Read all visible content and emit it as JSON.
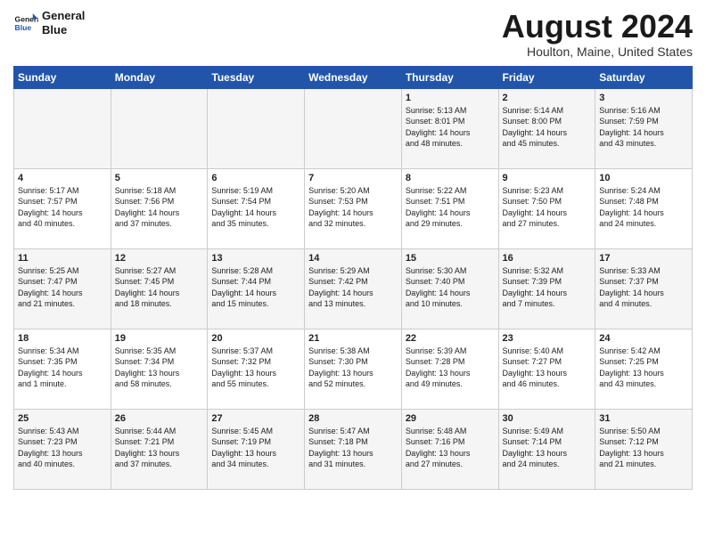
{
  "logo": {
    "line1": "General",
    "line2": "Blue"
  },
  "title": "August 2024",
  "location": "Houlton, Maine, United States",
  "headers": [
    "Sunday",
    "Monday",
    "Tuesday",
    "Wednesday",
    "Thursday",
    "Friday",
    "Saturday"
  ],
  "weeks": [
    [
      {
        "day": "",
        "detail": ""
      },
      {
        "day": "",
        "detail": ""
      },
      {
        "day": "",
        "detail": ""
      },
      {
        "day": "",
        "detail": ""
      },
      {
        "day": "1",
        "detail": "Sunrise: 5:13 AM\nSunset: 8:01 PM\nDaylight: 14 hours\nand 48 minutes."
      },
      {
        "day": "2",
        "detail": "Sunrise: 5:14 AM\nSunset: 8:00 PM\nDaylight: 14 hours\nand 45 minutes."
      },
      {
        "day": "3",
        "detail": "Sunrise: 5:16 AM\nSunset: 7:59 PM\nDaylight: 14 hours\nand 43 minutes."
      }
    ],
    [
      {
        "day": "4",
        "detail": "Sunrise: 5:17 AM\nSunset: 7:57 PM\nDaylight: 14 hours\nand 40 minutes."
      },
      {
        "day": "5",
        "detail": "Sunrise: 5:18 AM\nSunset: 7:56 PM\nDaylight: 14 hours\nand 37 minutes."
      },
      {
        "day": "6",
        "detail": "Sunrise: 5:19 AM\nSunset: 7:54 PM\nDaylight: 14 hours\nand 35 minutes."
      },
      {
        "day": "7",
        "detail": "Sunrise: 5:20 AM\nSunset: 7:53 PM\nDaylight: 14 hours\nand 32 minutes."
      },
      {
        "day": "8",
        "detail": "Sunrise: 5:22 AM\nSunset: 7:51 PM\nDaylight: 14 hours\nand 29 minutes."
      },
      {
        "day": "9",
        "detail": "Sunrise: 5:23 AM\nSunset: 7:50 PM\nDaylight: 14 hours\nand 27 minutes."
      },
      {
        "day": "10",
        "detail": "Sunrise: 5:24 AM\nSunset: 7:48 PM\nDaylight: 14 hours\nand 24 minutes."
      }
    ],
    [
      {
        "day": "11",
        "detail": "Sunrise: 5:25 AM\nSunset: 7:47 PM\nDaylight: 14 hours\nand 21 minutes."
      },
      {
        "day": "12",
        "detail": "Sunrise: 5:27 AM\nSunset: 7:45 PM\nDaylight: 14 hours\nand 18 minutes."
      },
      {
        "day": "13",
        "detail": "Sunrise: 5:28 AM\nSunset: 7:44 PM\nDaylight: 14 hours\nand 15 minutes."
      },
      {
        "day": "14",
        "detail": "Sunrise: 5:29 AM\nSunset: 7:42 PM\nDaylight: 14 hours\nand 13 minutes."
      },
      {
        "day": "15",
        "detail": "Sunrise: 5:30 AM\nSunset: 7:40 PM\nDaylight: 14 hours\nand 10 minutes."
      },
      {
        "day": "16",
        "detail": "Sunrise: 5:32 AM\nSunset: 7:39 PM\nDaylight: 14 hours\nand 7 minutes."
      },
      {
        "day": "17",
        "detail": "Sunrise: 5:33 AM\nSunset: 7:37 PM\nDaylight: 14 hours\nand 4 minutes."
      }
    ],
    [
      {
        "day": "18",
        "detail": "Sunrise: 5:34 AM\nSunset: 7:35 PM\nDaylight: 14 hours\nand 1 minute."
      },
      {
        "day": "19",
        "detail": "Sunrise: 5:35 AM\nSunset: 7:34 PM\nDaylight: 13 hours\nand 58 minutes."
      },
      {
        "day": "20",
        "detail": "Sunrise: 5:37 AM\nSunset: 7:32 PM\nDaylight: 13 hours\nand 55 minutes."
      },
      {
        "day": "21",
        "detail": "Sunrise: 5:38 AM\nSunset: 7:30 PM\nDaylight: 13 hours\nand 52 minutes."
      },
      {
        "day": "22",
        "detail": "Sunrise: 5:39 AM\nSunset: 7:28 PM\nDaylight: 13 hours\nand 49 minutes."
      },
      {
        "day": "23",
        "detail": "Sunrise: 5:40 AM\nSunset: 7:27 PM\nDaylight: 13 hours\nand 46 minutes."
      },
      {
        "day": "24",
        "detail": "Sunrise: 5:42 AM\nSunset: 7:25 PM\nDaylight: 13 hours\nand 43 minutes."
      }
    ],
    [
      {
        "day": "25",
        "detail": "Sunrise: 5:43 AM\nSunset: 7:23 PM\nDaylight: 13 hours\nand 40 minutes."
      },
      {
        "day": "26",
        "detail": "Sunrise: 5:44 AM\nSunset: 7:21 PM\nDaylight: 13 hours\nand 37 minutes."
      },
      {
        "day": "27",
        "detail": "Sunrise: 5:45 AM\nSunset: 7:19 PM\nDaylight: 13 hours\nand 34 minutes."
      },
      {
        "day": "28",
        "detail": "Sunrise: 5:47 AM\nSunset: 7:18 PM\nDaylight: 13 hours\nand 31 minutes."
      },
      {
        "day": "29",
        "detail": "Sunrise: 5:48 AM\nSunset: 7:16 PM\nDaylight: 13 hours\nand 27 minutes."
      },
      {
        "day": "30",
        "detail": "Sunrise: 5:49 AM\nSunset: 7:14 PM\nDaylight: 13 hours\nand 24 minutes."
      },
      {
        "day": "31",
        "detail": "Sunrise: 5:50 AM\nSunset: 7:12 PM\nDaylight: 13 hours\nand 21 minutes."
      }
    ]
  ]
}
